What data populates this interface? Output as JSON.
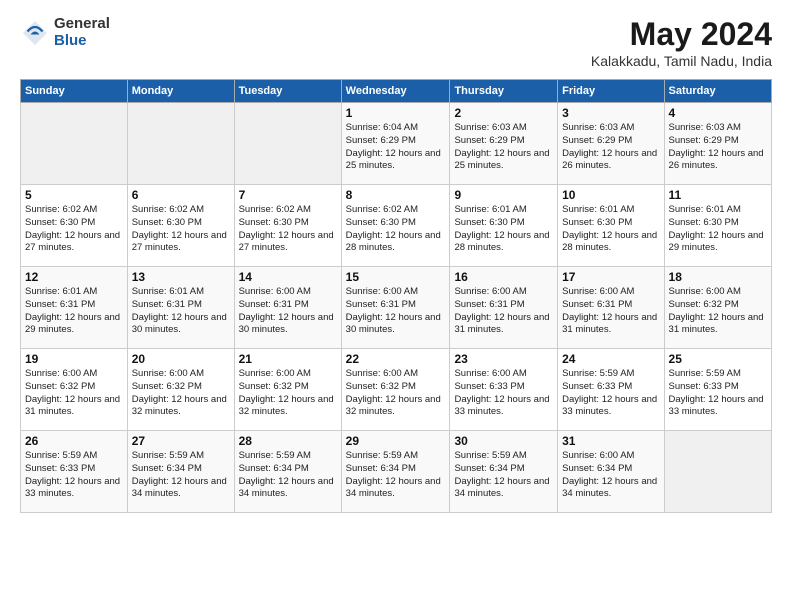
{
  "logo": {
    "general": "General",
    "blue": "Blue"
  },
  "title": "May 2024",
  "subtitle": "Kalakkadu, Tamil Nadu, India",
  "days_of_week": [
    "Sunday",
    "Monday",
    "Tuesday",
    "Wednesday",
    "Thursday",
    "Friday",
    "Saturday"
  ],
  "weeks": [
    [
      {
        "day": "",
        "info": ""
      },
      {
        "day": "",
        "info": ""
      },
      {
        "day": "",
        "info": ""
      },
      {
        "day": "1",
        "info": "Sunrise: 6:04 AM\nSunset: 6:29 PM\nDaylight: 12 hours\nand 25 minutes."
      },
      {
        "day": "2",
        "info": "Sunrise: 6:03 AM\nSunset: 6:29 PM\nDaylight: 12 hours\nand 25 minutes."
      },
      {
        "day": "3",
        "info": "Sunrise: 6:03 AM\nSunset: 6:29 PM\nDaylight: 12 hours\nand 26 minutes."
      },
      {
        "day": "4",
        "info": "Sunrise: 6:03 AM\nSunset: 6:29 PM\nDaylight: 12 hours\nand 26 minutes."
      }
    ],
    [
      {
        "day": "5",
        "info": "Sunrise: 6:02 AM\nSunset: 6:30 PM\nDaylight: 12 hours\nand 27 minutes."
      },
      {
        "day": "6",
        "info": "Sunrise: 6:02 AM\nSunset: 6:30 PM\nDaylight: 12 hours\nand 27 minutes."
      },
      {
        "day": "7",
        "info": "Sunrise: 6:02 AM\nSunset: 6:30 PM\nDaylight: 12 hours\nand 27 minutes."
      },
      {
        "day": "8",
        "info": "Sunrise: 6:02 AM\nSunset: 6:30 PM\nDaylight: 12 hours\nand 28 minutes."
      },
      {
        "day": "9",
        "info": "Sunrise: 6:01 AM\nSunset: 6:30 PM\nDaylight: 12 hours\nand 28 minutes."
      },
      {
        "day": "10",
        "info": "Sunrise: 6:01 AM\nSunset: 6:30 PM\nDaylight: 12 hours\nand 28 minutes."
      },
      {
        "day": "11",
        "info": "Sunrise: 6:01 AM\nSunset: 6:30 PM\nDaylight: 12 hours\nand 29 minutes."
      }
    ],
    [
      {
        "day": "12",
        "info": "Sunrise: 6:01 AM\nSunset: 6:31 PM\nDaylight: 12 hours\nand 29 minutes."
      },
      {
        "day": "13",
        "info": "Sunrise: 6:01 AM\nSunset: 6:31 PM\nDaylight: 12 hours\nand 30 minutes."
      },
      {
        "day": "14",
        "info": "Sunrise: 6:00 AM\nSunset: 6:31 PM\nDaylight: 12 hours\nand 30 minutes."
      },
      {
        "day": "15",
        "info": "Sunrise: 6:00 AM\nSunset: 6:31 PM\nDaylight: 12 hours\nand 30 minutes."
      },
      {
        "day": "16",
        "info": "Sunrise: 6:00 AM\nSunset: 6:31 PM\nDaylight: 12 hours\nand 31 minutes."
      },
      {
        "day": "17",
        "info": "Sunrise: 6:00 AM\nSunset: 6:31 PM\nDaylight: 12 hours\nand 31 minutes."
      },
      {
        "day": "18",
        "info": "Sunrise: 6:00 AM\nSunset: 6:32 PM\nDaylight: 12 hours\nand 31 minutes."
      }
    ],
    [
      {
        "day": "19",
        "info": "Sunrise: 6:00 AM\nSunset: 6:32 PM\nDaylight: 12 hours\nand 31 minutes."
      },
      {
        "day": "20",
        "info": "Sunrise: 6:00 AM\nSunset: 6:32 PM\nDaylight: 12 hours\nand 32 minutes."
      },
      {
        "day": "21",
        "info": "Sunrise: 6:00 AM\nSunset: 6:32 PM\nDaylight: 12 hours\nand 32 minutes."
      },
      {
        "day": "22",
        "info": "Sunrise: 6:00 AM\nSunset: 6:32 PM\nDaylight: 12 hours\nand 32 minutes."
      },
      {
        "day": "23",
        "info": "Sunrise: 6:00 AM\nSunset: 6:33 PM\nDaylight: 12 hours\nand 33 minutes."
      },
      {
        "day": "24",
        "info": "Sunrise: 5:59 AM\nSunset: 6:33 PM\nDaylight: 12 hours\nand 33 minutes."
      },
      {
        "day": "25",
        "info": "Sunrise: 5:59 AM\nSunset: 6:33 PM\nDaylight: 12 hours\nand 33 minutes."
      }
    ],
    [
      {
        "day": "26",
        "info": "Sunrise: 5:59 AM\nSunset: 6:33 PM\nDaylight: 12 hours\nand 33 minutes."
      },
      {
        "day": "27",
        "info": "Sunrise: 5:59 AM\nSunset: 6:34 PM\nDaylight: 12 hours\nand 34 minutes."
      },
      {
        "day": "28",
        "info": "Sunrise: 5:59 AM\nSunset: 6:34 PM\nDaylight: 12 hours\nand 34 minutes."
      },
      {
        "day": "29",
        "info": "Sunrise: 5:59 AM\nSunset: 6:34 PM\nDaylight: 12 hours\nand 34 minutes."
      },
      {
        "day": "30",
        "info": "Sunrise: 5:59 AM\nSunset: 6:34 PM\nDaylight: 12 hours\nand 34 minutes."
      },
      {
        "day": "31",
        "info": "Sunrise: 6:00 AM\nSunset: 6:34 PM\nDaylight: 12 hours\nand 34 minutes."
      },
      {
        "day": "",
        "info": ""
      }
    ]
  ]
}
